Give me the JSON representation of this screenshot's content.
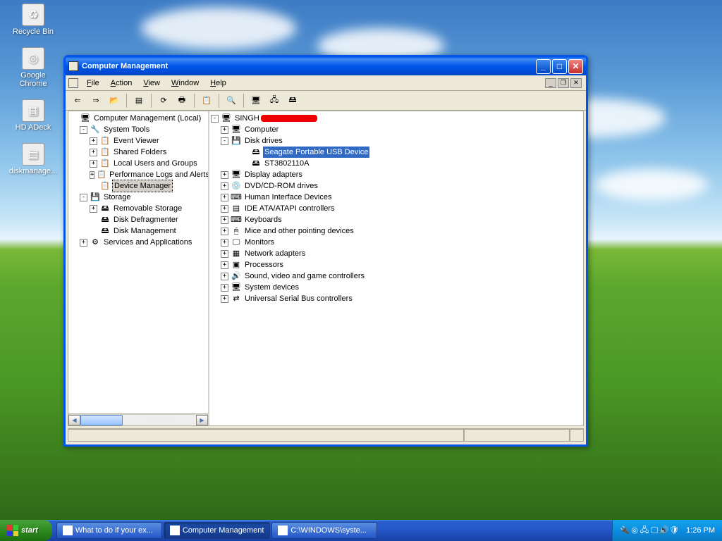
{
  "desktop_icons": [
    {
      "name": "recycle-bin",
      "label": "Recycle Bin",
      "glyph": "♻"
    },
    {
      "name": "google-chrome",
      "label": "Google Chrome",
      "glyph": "◎"
    },
    {
      "name": "hd-adeck",
      "label": "HD ADeck",
      "glyph": "▦"
    },
    {
      "name": "diskmanage",
      "label": "diskmanage...",
      "glyph": "▤"
    }
  ],
  "window": {
    "title": "Computer Management",
    "menu": [
      "File",
      "Action",
      "View",
      "Window",
      "Help"
    ],
    "toolbar_icons": [
      "back-icon",
      "forward-icon",
      "up-folder-icon",
      "sep",
      "properties-icon",
      "sep",
      "refresh-icon",
      "print-icon",
      "sep",
      "export-icon",
      "sep",
      "scan-icon",
      "sep",
      "device1-icon",
      "device2-icon",
      "device3-icon"
    ],
    "left_tree": {
      "root": "Computer Management (Local)",
      "sys_tools": "System Tools",
      "sys_tools_items": [
        {
          "label": "Event Viewer",
          "plus": true
        },
        {
          "label": "Shared Folders",
          "plus": true
        },
        {
          "label": "Local Users and Groups",
          "plus": true
        },
        {
          "label": "Performance Logs and Alerts",
          "plus": true
        },
        {
          "label": "Device Manager",
          "plus": false,
          "selected": true
        }
      ],
      "storage": "Storage",
      "storage_items": [
        {
          "label": "Removable Storage",
          "plus": true
        },
        {
          "label": "Disk Defragmenter",
          "plus": false
        },
        {
          "label": "Disk Management",
          "plus": false
        }
      ],
      "services": "Services and Applications"
    },
    "right_tree": {
      "computer_name": "SINGH",
      "items": [
        {
          "label": "Computer",
          "plus": true,
          "icon": "🖥"
        },
        {
          "label": "Disk drives",
          "plus": true,
          "open": true,
          "icon": "💾",
          "children": [
            {
              "label": "Seagate Portable USB Device",
              "selected": true
            },
            {
              "label": "ST3802110A"
            }
          ]
        },
        {
          "label": "Display adapters",
          "plus": true,
          "icon": "🖥"
        },
        {
          "label": "DVD/CD-ROM drives",
          "plus": true,
          "icon": "💿"
        },
        {
          "label": "Human Interface Devices",
          "plus": true,
          "icon": "⌨"
        },
        {
          "label": "IDE ATA/ATAPI controllers",
          "plus": true,
          "icon": "▤"
        },
        {
          "label": "Keyboards",
          "plus": true,
          "icon": "⌨"
        },
        {
          "label": "Mice and other pointing devices",
          "plus": true,
          "icon": "🖱"
        },
        {
          "label": "Monitors",
          "plus": true,
          "icon": "🖵"
        },
        {
          "label": "Network adapters",
          "plus": true,
          "icon": "▦"
        },
        {
          "label": "Processors",
          "plus": true,
          "icon": "▣"
        },
        {
          "label": "Sound, video and game controllers",
          "plus": true,
          "icon": "🔊"
        },
        {
          "label": "System devices",
          "plus": true,
          "icon": "🖥"
        },
        {
          "label": "Universal Serial Bus controllers",
          "plus": true,
          "icon": "⇄"
        }
      ]
    }
  },
  "taskbar": {
    "start": "start",
    "items": [
      {
        "label": "What to do if your ex...",
        "icon": "chrome",
        "active": false
      },
      {
        "label": "Computer Management",
        "icon": "mmc",
        "active": true
      },
      {
        "label": "C:\\WINDOWS\\syste...",
        "icon": "cmd",
        "active": false
      }
    ],
    "tray_icons": [
      "safely-remove-icon",
      "chrome-icon",
      "network-icon",
      "display-icon",
      "volume-icon",
      "shield-icon"
    ],
    "time": "1:26 PM"
  }
}
